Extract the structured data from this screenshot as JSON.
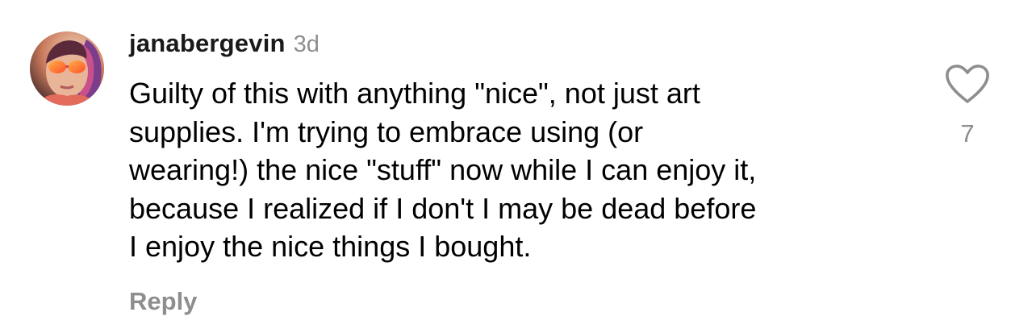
{
  "comment": {
    "username": "janabergevin",
    "timestamp": "3d",
    "lines": [
      "Guilty of this with anything \"nice\", not just art",
      "supplies. I'm trying to embrace using (or",
      "wearing!) the nice \"stuff\" now while I can enjoy it,",
      "because I realized if I don't I may be dead before",
      "I enjoy the nice things I bought."
    ],
    "reply_label": "Reply",
    "like_count": "7",
    "like_icon": "heart-outline-icon"
  },
  "colors": {
    "text": "#000000",
    "muted": "#8e8e8e",
    "background": "#ffffff"
  }
}
